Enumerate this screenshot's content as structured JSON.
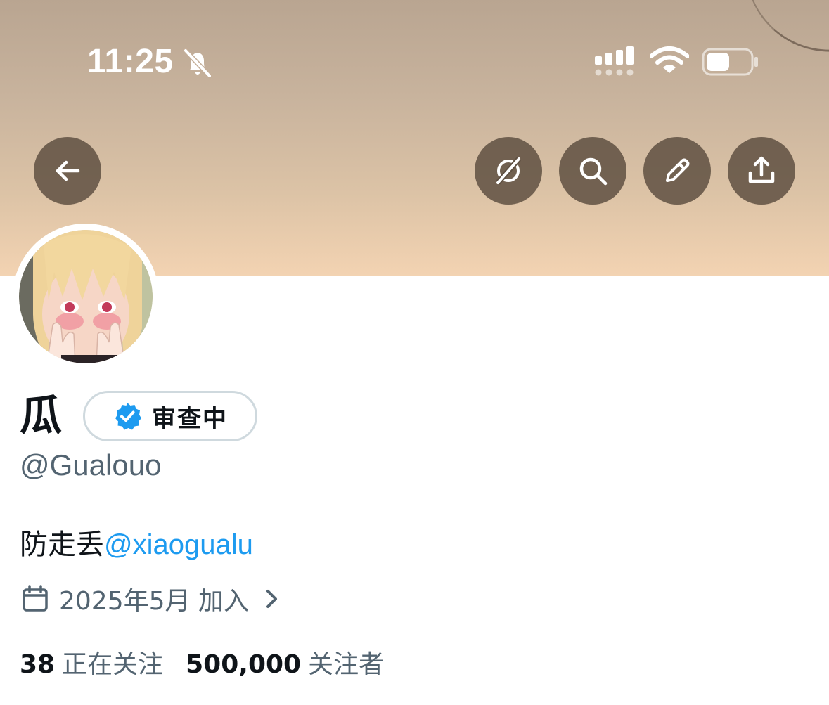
{
  "status_bar": {
    "time": "11:25",
    "icons": [
      "bell-off-icon",
      "cellular-signal-icon",
      "wifi-icon",
      "battery-icon"
    ]
  },
  "header": {
    "buttons": [
      {
        "name": "back",
        "icon": "arrow-left-icon"
      },
      {
        "name": "grok",
        "icon": "grok-icon"
      },
      {
        "name": "search",
        "icon": "search-icon"
      },
      {
        "name": "edit",
        "icon": "pencil-icon"
      },
      {
        "name": "share",
        "icon": "share-icon"
      }
    ]
  },
  "profile": {
    "display_name": "瓜",
    "verification_label": "审查中",
    "handle": "@Gualouo",
    "bio_text": "防走丢",
    "bio_mention": "@xiaogualu",
    "joined": "2025年5月 加入",
    "following_count": "38",
    "following_label": "正在关注",
    "followers_count": "500,000",
    "followers_label": "关注者"
  },
  "colors": {
    "text_primary": "#0f1419",
    "text_secondary": "#536471",
    "link": "#1d9bf0",
    "verified": "#1d9bf0",
    "button_bg": "#5f5042"
  }
}
